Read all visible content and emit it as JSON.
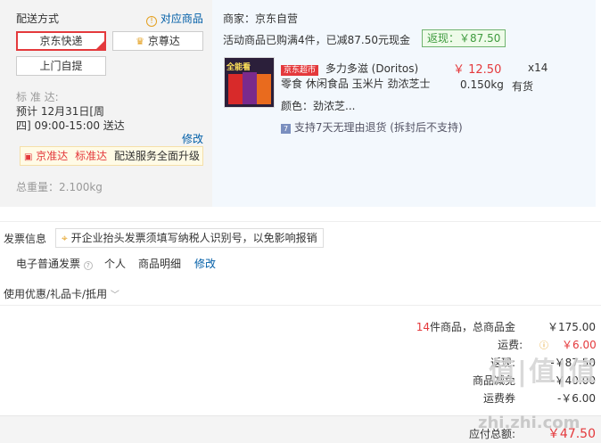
{
  "delivery": {
    "title": "配送方式",
    "match_link": "对应商品",
    "options": [
      "京东快递",
      "京尊达",
      "上门自提"
    ],
    "schedule_label": "标 准 达:",
    "schedule_line1": "预计 12月31日[周",
    "schedule_line2": "四] 09:00-15:00 送达",
    "modify": "修改",
    "promo_brand": "京准达",
    "promo_mid": "标准达",
    "promo_text": "配送服务全面升级",
    "weight": "总重量：2.100kg"
  },
  "merchant": {
    "seller": "商家：京东自营",
    "activity": "活动商品已购满4件，已减87.50元现金",
    "rebate": "返现：￥87.50"
  },
  "product": {
    "badge": "京东超市",
    "name_line1": "多力多滋 (Doritos)",
    "name_line2": "零食 休闲食品 玉米片 劲浓芝士",
    "price": "￥ 12.50",
    "quantity": "x14",
    "weight": "0.150kg",
    "stock": "有货",
    "color": "颜色：劲浓芝...",
    "returns": "支持7天无理由退货 (拆封后不支持)",
    "image_text": "全能看",
    "colors": {
      "bag1": "#d82a2a",
      "bag2": "#7a2a8c",
      "bag3": "#e96b1e"
    }
  },
  "invoice": {
    "title": "发票信息",
    "tip": "开企业抬头发票须填写纳税人识别号，以免影响报销",
    "type": "电子普通发票",
    "person": "个人",
    "detail": "商品明细",
    "modify": "修改"
  },
  "coupon": {
    "label": "使用优惠/礼品卡/抵用"
  },
  "summary": {
    "count": "14",
    "count_suffix": "件商品，总商品金",
    "total": "￥175.00",
    "shipping_label": "运费:",
    "shipping": "￥6.00",
    "rebate_label": "返现:",
    "rebate": "-￥87.50",
    "r4_label": "商品减免",
    "r4_value": "-￥40.00",
    "r5_label": "运费券",
    "r5_value": "-￥6.00",
    "pay_label": "应付总额:",
    "pay_value": "￥47.50"
  },
  "watermark": {
    "main": "值|值|值",
    "site": "zhi.zhi.com"
  }
}
